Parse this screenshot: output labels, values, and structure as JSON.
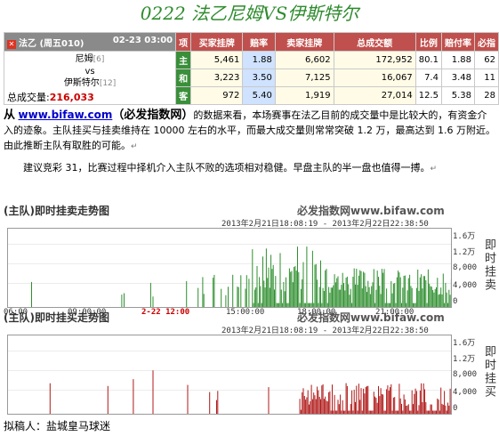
{
  "title": "0222 法乙尼姆VS伊斯特尔",
  "match": {
    "league": "法乙 (周五010)",
    "time": "02-23 03:00",
    "col_item": "项",
    "headers": [
      "买家挂牌",
      "赔率",
      "卖家挂牌",
      "总成交额",
      "比例",
      "赔付率",
      "必指"
    ],
    "home": "尼姆",
    "home_rank": "[6]",
    "vs": "vs",
    "away": "伊斯特尔",
    "away_rank": "[12]",
    "volume_label": "总成交量:",
    "volume": "216,033",
    "rows": [
      {
        "label": "主",
        "buy": "5,461",
        "odds": "1.88",
        "sell": "6,602",
        "total": "172,952",
        "ratio": "80.1",
        "payout": "1.88",
        "index": "62"
      },
      {
        "label": "和",
        "buy": "3,223",
        "odds": "3.50",
        "sell": "7,125",
        "total": "16,067",
        "ratio": "7.4",
        "payout": "3.48",
        "index": "11"
      },
      {
        "label": "客",
        "buy": "972",
        "odds": "5.40",
        "sell": "1,919",
        "total": "27,014",
        "ratio": "12.5",
        "payout": "5.38",
        "index": "28"
      }
    ]
  },
  "article": {
    "p1_lead": "从",
    "p1_link": "www.bifaw.com",
    "p1_brand": "（必发指数网）",
    "p1_rest": "的数据来看，本场赛事在法乙目前的成交量中是比较大的，有资金介入的迹象。主队挂买与挂卖维持在 10000 左右的水平，而最大成交量则常常突破 1.2 万，最高达到 1.6 万附近。由此推断主队有取胜的可能。",
    "p2": "建议竞彩 31，比赛过程中择机介入主队不败的选项相对稳健。早盘主队的半一盘也值得一搏。",
    "ret": "↵"
  },
  "charts": [
    {
      "title": "(主队)即时挂卖走势图",
      "brand": "必发指数网www.bifaw.com",
      "range": "2013年2月21日18:08:19 - 2013年2月22日22:38:50",
      "yticks": [
        "1.6万",
        "1.2万",
        "8,000",
        "4,000",
        "0"
      ],
      "ylabel": "即时挂卖",
      "xticks": [
        "06:00",
        "09:00:00",
        "2-22 12:00",
        "15:00:00",
        "18:00:00",
        "21:00:00"
      ],
      "color": "#2f8f2f"
    },
    {
      "title": "(主队)即时挂买走势图",
      "brand": "必发指数网www.bifaw.com",
      "range": "2013年2月21日18:08:19 - 2013年2月22日22:38:50",
      "yticks": [
        "1.6万",
        "1.2万",
        "8,000",
        "4,000",
        "0"
      ],
      "ylabel": "即时挂买",
      "color": "#b01818"
    }
  ],
  "footer": "拟稿人：盐城皇马球迷"
}
